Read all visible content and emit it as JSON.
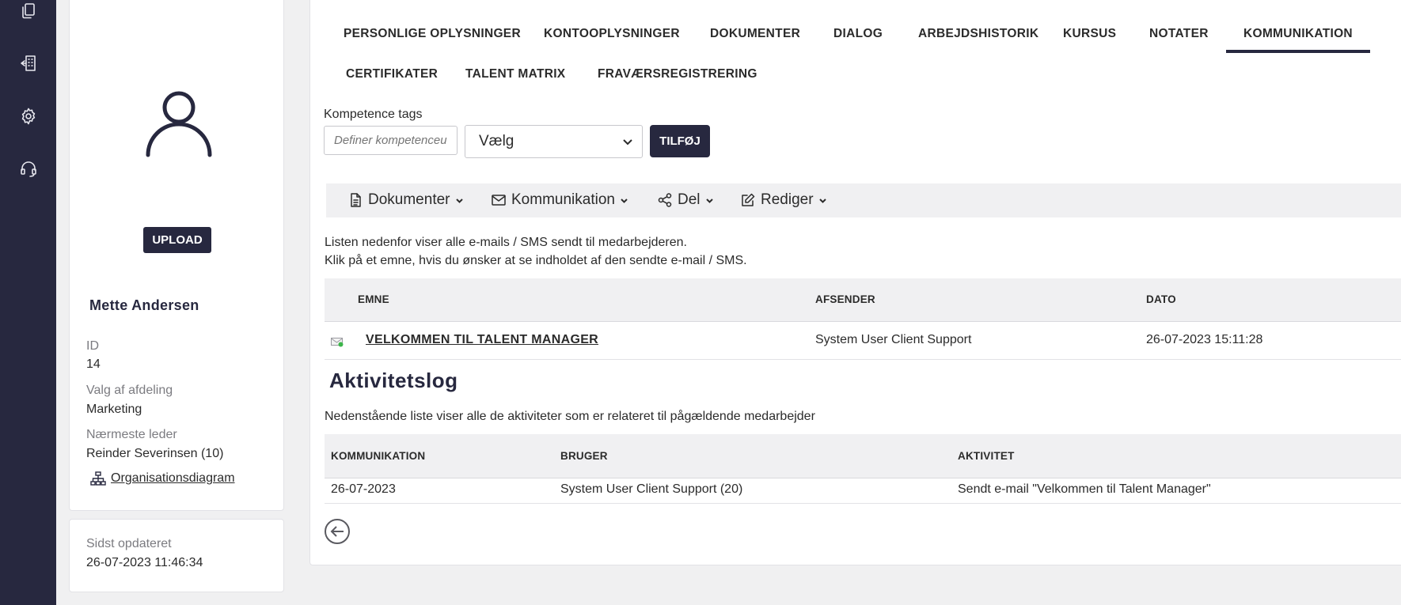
{
  "rail": {
    "items": [
      {
        "icon": "copy-icon"
      },
      {
        "icon": "building-icon"
      },
      {
        "icon": "gear-icon"
      },
      {
        "icon": "headset-icon"
      }
    ]
  },
  "profile": {
    "upload_label": "UPLOAD",
    "name": "Mette Andersen",
    "fields": [
      {
        "label": "ID",
        "value": "14"
      },
      {
        "label": "Valg af afdeling",
        "value": "Marketing"
      },
      {
        "label": "Nærmeste leder",
        "value": "Reinder Severinsen (10)"
      }
    ],
    "org_link": "Organisationsdiagram",
    "updated_label": "Sidst opdateret",
    "updated_value": "26-07-2023 11:46:34"
  },
  "tabs": [
    {
      "label": "PERSONLIGE OPLYSNINGER",
      "active": false
    },
    {
      "label": "KONTOOPLYSNINGER",
      "active": false
    },
    {
      "label": "DOKUMENTER",
      "active": false
    },
    {
      "label": "DIALOG",
      "active": false
    },
    {
      "label": "ARBEJDSHISTORIK",
      "active": false
    },
    {
      "label": "KURSUS",
      "active": false
    },
    {
      "label": "NOTATER",
      "active": false
    },
    {
      "label": "KOMMUNIKATION",
      "active": true
    },
    {
      "label": "CERTIFIKATER",
      "active": false
    },
    {
      "label": "TALENT MATRIX",
      "active": false
    },
    {
      "label": "FRAVÆRSREGISTRERING",
      "active": false
    }
  ],
  "competence": {
    "label": "Kompetence tags",
    "placeholder": "Definer kompetenceud",
    "select_value": "Vælg",
    "add_label": "TILFØJ"
  },
  "toolbar": {
    "items": [
      {
        "label": "Dokumenter",
        "icon": "document-icon"
      },
      {
        "label": "Kommunikation",
        "icon": "envelope-icon"
      },
      {
        "label": "Del",
        "icon": "share-icon"
      },
      {
        "label": "Rediger",
        "icon": "edit-icon"
      }
    ]
  },
  "messages": {
    "intro_line1": "Listen nedenfor viser alle e-mails / SMS sendt til medarbejderen.",
    "intro_line2": "Klik på et emne, hvis du ønsker at se indholdet af den sendte e-mail / SMS.",
    "columns": [
      "EMNE",
      "AFSENDER",
      "DATO"
    ],
    "rows": [
      {
        "subject": "VELKOMMEN TIL TALENT MANAGER",
        "sender": "System User Client Support",
        "date": "26-07-2023 15:11:28"
      }
    ]
  },
  "activity": {
    "title": "Aktivitetslog",
    "intro": "Nedenstående liste viser alle de aktiviteter som er relateret til pågældende medarbejder",
    "columns": [
      "KOMMUNIKATION",
      "BRUGER",
      "AKTIVITET"
    ],
    "rows": [
      {
        "communication": "26-07-2023",
        "user": "System User Client Support (20)",
        "activity": "Sendt e-mail \"Velkommen til Talent Manager\""
      }
    ]
  },
  "colors": {
    "brand_dark": "#27283f",
    "panel_bg": "#f0f0f1"
  }
}
